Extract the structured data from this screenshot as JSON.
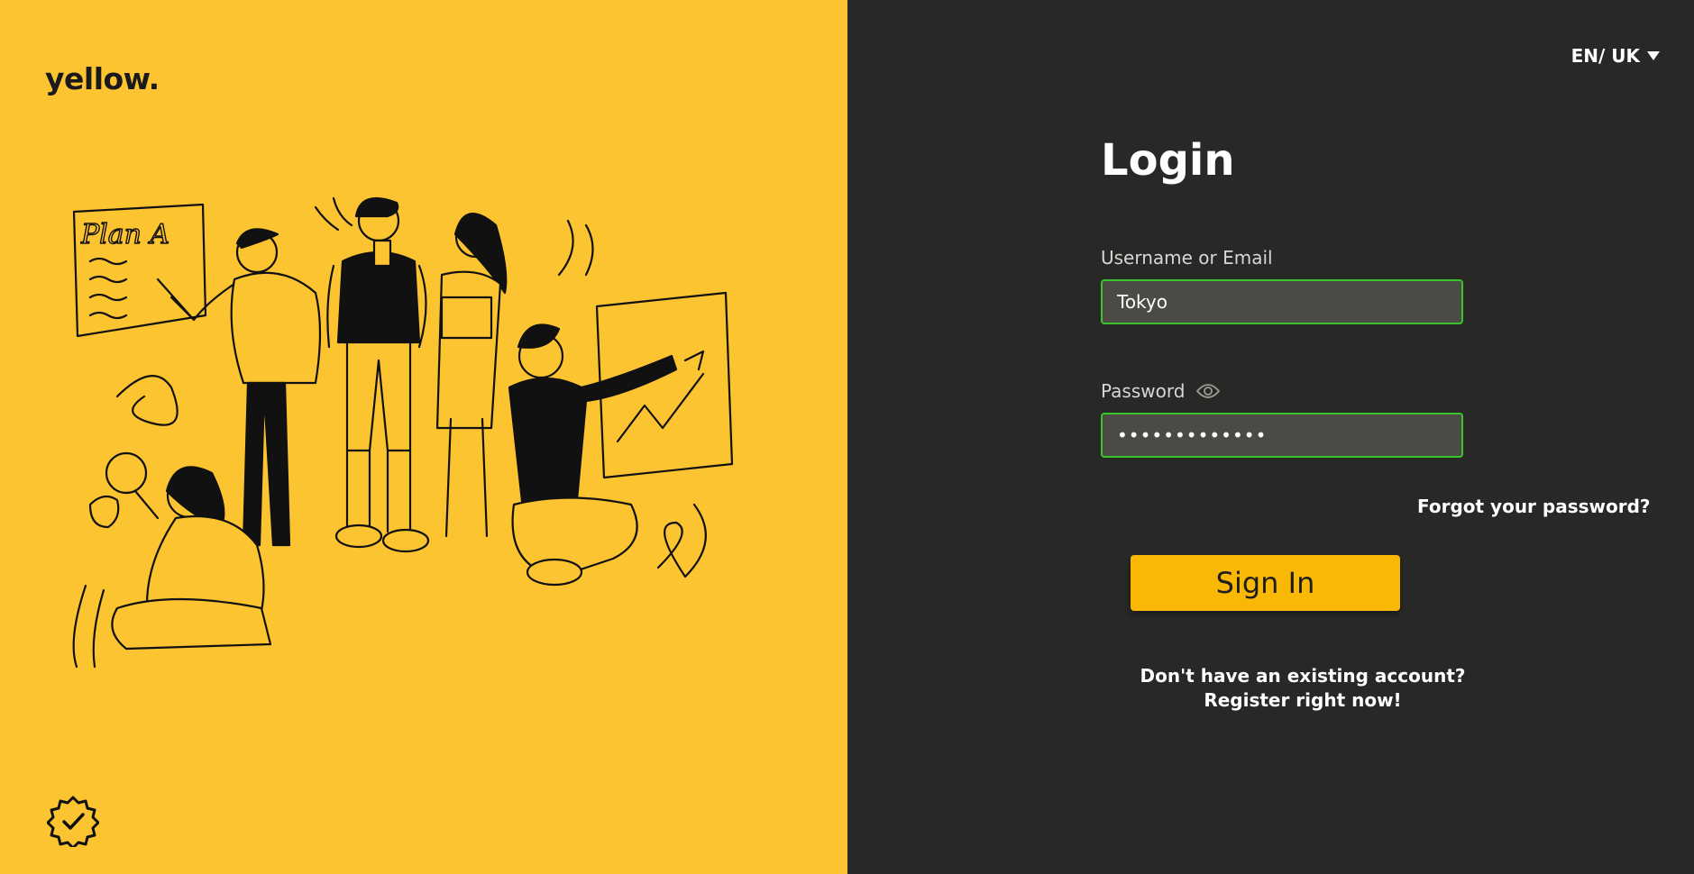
{
  "brand": {
    "logo_text": "yellow."
  },
  "language": {
    "label": "EN/ UK",
    "icon": "caret-down-icon"
  },
  "login": {
    "title": "Login",
    "username_label": "Username or Email",
    "username_value": "Tokyo",
    "password_label": "Password",
    "password_value": "•••••••••••••",
    "password_toggle_icon": "eye-icon",
    "forgot_text": "Forgot your password?",
    "signin_label": "Sign In",
    "no_account_text": "Don't have an existing account?",
    "register_text": "Register right now!"
  },
  "colors": {
    "left_bg": "#fdc432",
    "right_bg": "#282826",
    "accent": "#f9b805",
    "field_border": "#38c42a"
  },
  "illustration": {
    "whiteboard_text": "Plan A"
  },
  "badge": {
    "icon": "verified-badge-icon"
  }
}
